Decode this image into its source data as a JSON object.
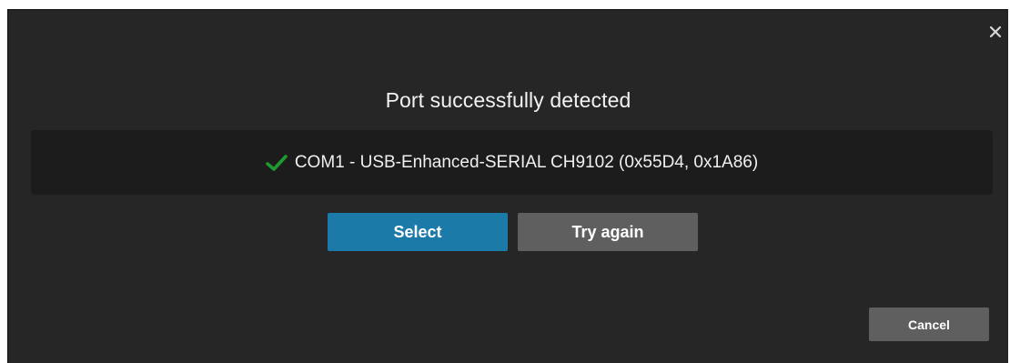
{
  "dialog": {
    "title": "Port successfully detected",
    "close_icon": "close-icon",
    "port": {
      "status_icon": "check-icon",
      "status_color": "#1f9a2f",
      "label": "COM1 - USB-Enhanced-SERIAL CH9102 (0x55D4, 0x1A86)"
    },
    "buttons": {
      "select_label": "Select",
      "try_again_label": "Try again",
      "cancel_label": "Cancel"
    },
    "colors": {
      "background": "#262626",
      "panel": "#1c1c1c",
      "primary": "#1c7aa8",
      "secondary": "#5f5f5f"
    }
  }
}
